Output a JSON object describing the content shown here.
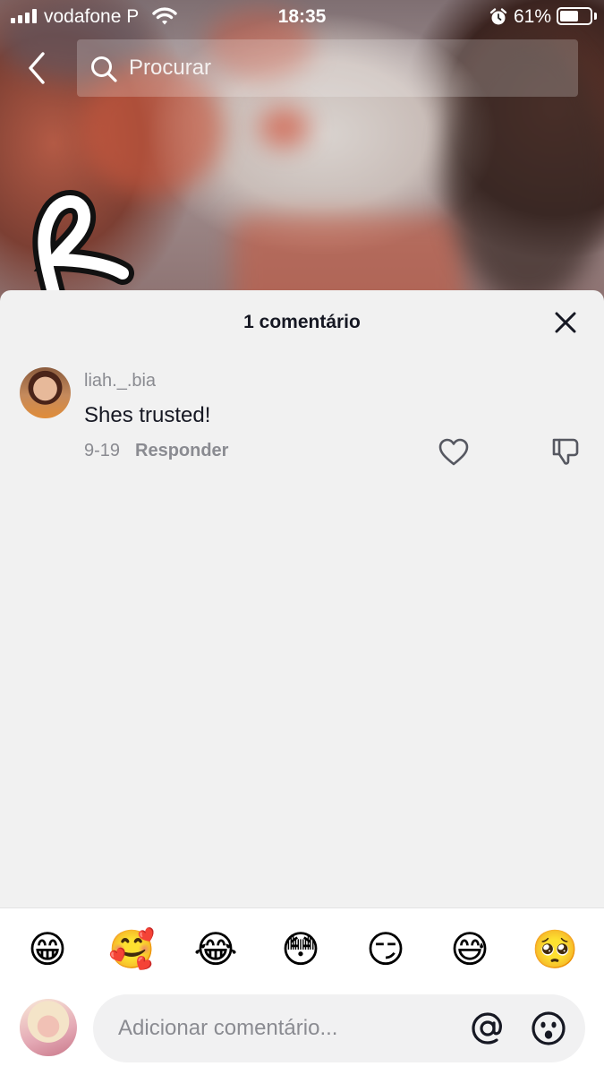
{
  "status_bar": {
    "carrier": "vodafone P",
    "time": "18:35",
    "battery_percent": "61%",
    "battery_level": 0.61
  },
  "top_nav": {
    "back_icon": "chevron-left-icon",
    "search_placeholder": "Procurar"
  },
  "comments_sheet": {
    "title": "1 comentário",
    "close_icon": "close-icon",
    "comments": [
      {
        "username": "liah._.bia",
        "text": "Shes trusted!",
        "date": "9-19",
        "reply_label": "Responder",
        "like_icon": "heart-outline-icon",
        "dislike_icon": "thumbs-down-icon"
      }
    ]
  },
  "emoji_bar": [
    "😁",
    "🥰",
    "😂",
    "😳",
    "😏",
    "😅",
    "🥺"
  ],
  "comment_input": {
    "placeholder": "Adicionar comentário...",
    "mention_icon": "at-sign-icon",
    "emoji_icon": "emoji-face-icon"
  }
}
